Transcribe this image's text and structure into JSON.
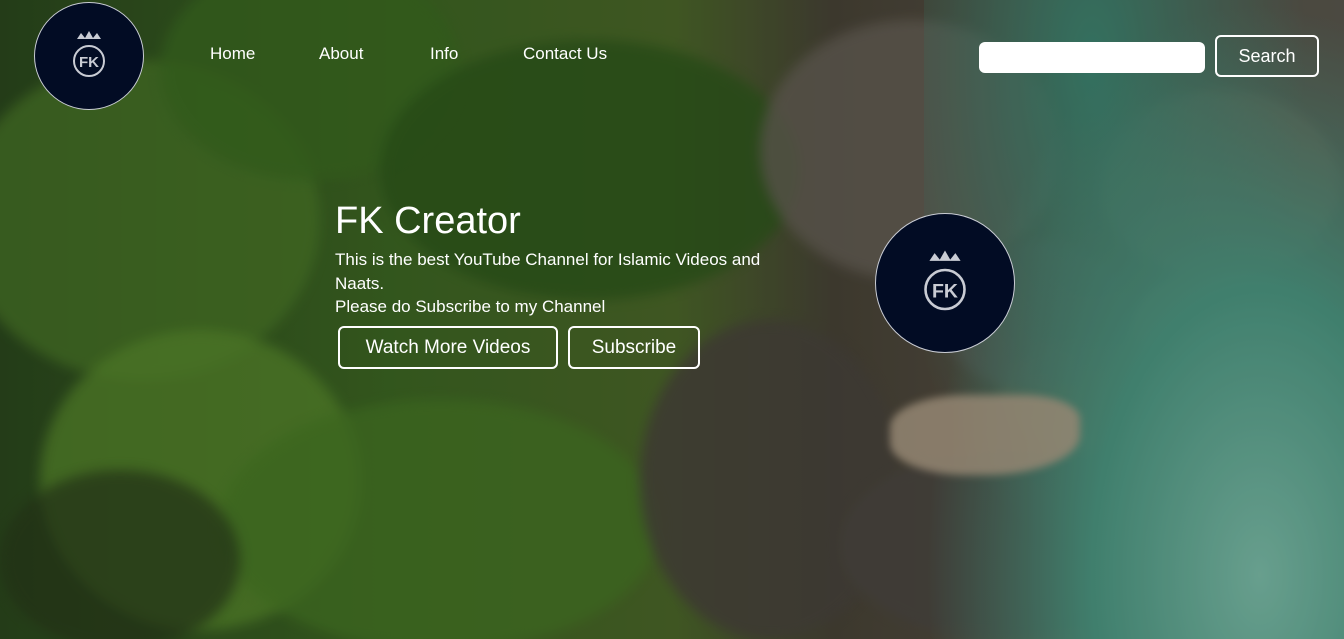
{
  "nav": {
    "logo_text": "FK",
    "items": [
      {
        "label": "Home"
      },
      {
        "label": "About"
      },
      {
        "label": "Info"
      },
      {
        "label": "Contact Us"
      }
    ]
  },
  "search": {
    "placeholder": "",
    "value": "",
    "button_label": "Search"
  },
  "hero": {
    "title": "FK Creator",
    "description": "This is the best YouTube Channel for Islamic Videos and Naats.",
    "cta_text": "Please do Subscribe to my Channel",
    "buttons": [
      {
        "label": "Watch More Videos"
      },
      {
        "label": "Subscribe"
      }
    ],
    "logo_text": "FK"
  },
  "colors": {
    "logo_bg": "#020c24",
    "logo_fg": "#c9ccd4",
    "text": "#ffffff"
  }
}
